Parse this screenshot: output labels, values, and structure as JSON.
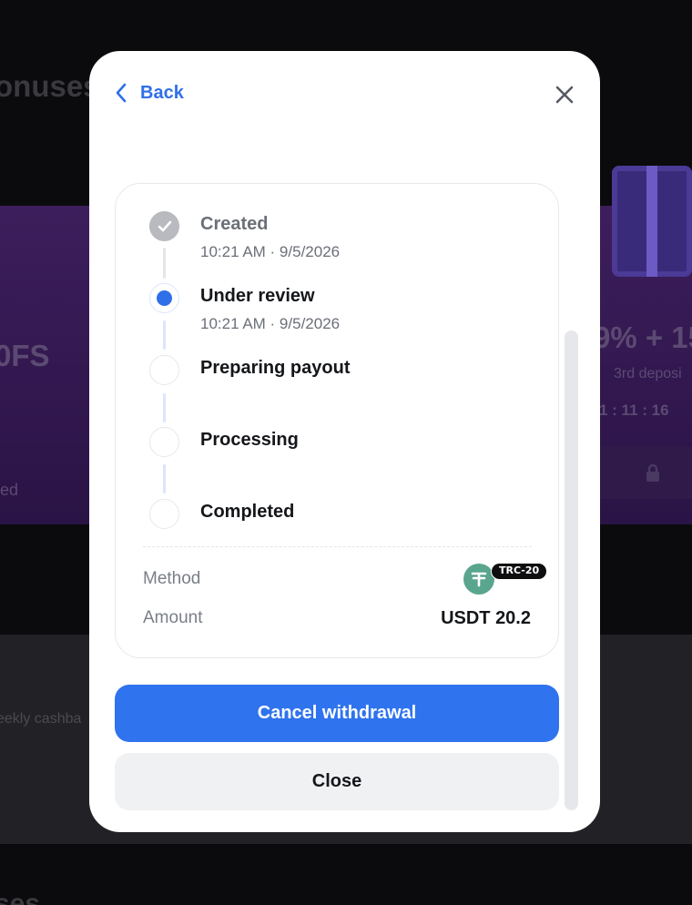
{
  "background": {
    "title": "onuses",
    "left_card_value": "0FS",
    "left_card_status": "ed",
    "right_card_value": "9% + 15",
    "right_card_caption": "3rd deposi",
    "right_card_timer": "1 : 11 : 16",
    "strip_text": "eekly cashba",
    "bottom_title": "ses"
  },
  "modal": {
    "back_label": "Back",
    "steps": [
      {
        "title": "Created",
        "time": "10:21 AM · 9/5/2026",
        "state": "done"
      },
      {
        "title": "Under review",
        "time": "10:21 AM · 9/5/2026",
        "state": "active"
      },
      {
        "title": "Preparing payout",
        "time": "",
        "state": "pending"
      },
      {
        "title": "Processing",
        "time": "",
        "state": "pending"
      },
      {
        "title": "Completed",
        "time": "",
        "state": "pending"
      }
    ],
    "method_label": "Method",
    "method_network": "TRC-20",
    "amount_label": "Amount",
    "amount_value": "USDT 20.2",
    "cancel_label": "Cancel withdrawal",
    "close_label": "Close"
  },
  "colors": {
    "accent": "#2f73ee",
    "tether_green": "#5aa58e",
    "muted_text": "#6b6f78"
  },
  "icons": {
    "back": "chevron-left-icon",
    "close": "close-icon",
    "done_step": "check-icon",
    "method": "tether-icon",
    "locked": "lock-icon"
  }
}
